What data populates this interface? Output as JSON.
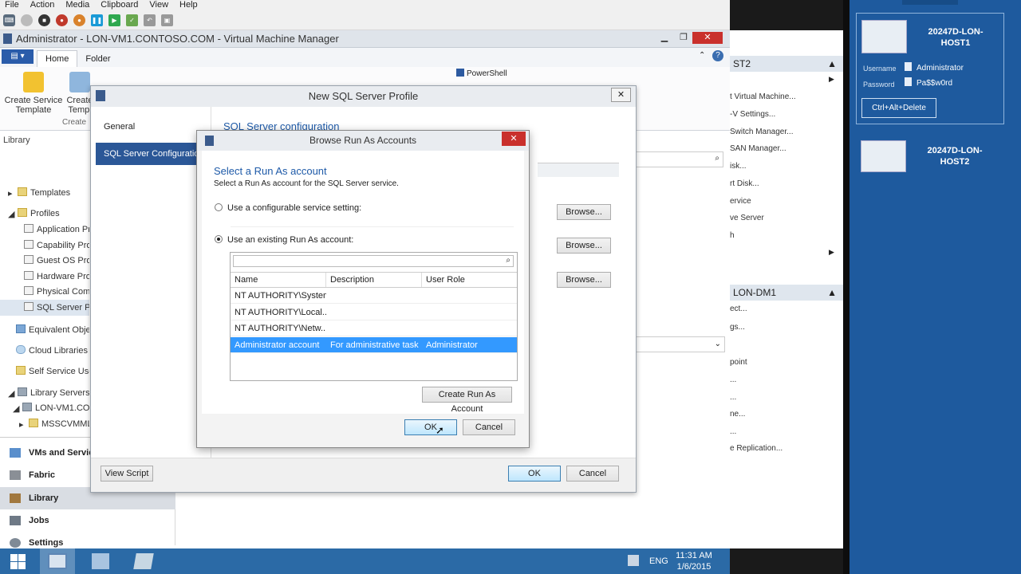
{
  "host_menu": [
    "File",
    "Action",
    "Media",
    "Clipboard",
    "View",
    "Help"
  ],
  "window": {
    "title": "Administrator - LON-VM1.CONTOSO.COM - Virtual Machine Manager",
    "tabs": [
      "Home",
      "Folder"
    ],
    "ribbon": {
      "create_service_template": "Create Service Template",
      "create_template": "Create Templ",
      "group_label": "Create",
      "powershell": "PowerShell"
    }
  },
  "nav": {
    "section": "Library",
    "items": [
      "Templates",
      "Profiles",
      "Application Pr",
      "Capability Prof",
      "Guest OS Profi",
      "Hardware Profi",
      "Physical Comp",
      "SQL Server Pro",
      "Equivalent Obje",
      "Cloud Libraries",
      "Self Service Use",
      "Library Servers",
      "LON-VM1.CON",
      "MSSCVMML"
    ],
    "workspaces": [
      "VMs and Servic",
      "Fabric",
      "Library",
      "Jobs",
      "Settings"
    ]
  },
  "actions": {
    "group1_header": "ST2",
    "group1": [
      "t Virtual Machine...",
      "-V Settings...",
      "Switch Manager...",
      "SAN Manager...",
      "isk...",
      "rt Disk...",
      "ervice",
      "ve Server",
      "h"
    ],
    "group2_header": "LON-DM1",
    "group2": [
      "ect...",
      "gs...",
      "point",
      "...",
      "...",
      "ne...",
      "...",
      "e Replication..."
    ]
  },
  "profile_dialog": {
    "title": "New SQL Server Profile",
    "nav": [
      "General",
      "SQL Server Configuration"
    ],
    "heading": "SQL Server configuration",
    "browse_label": "Browse...",
    "view_script": "View Script",
    "ok": "OK",
    "cancel": "Cancel"
  },
  "browse_dialog": {
    "title": "Browse Run As Accounts",
    "heading": "Select a Run As account",
    "subheading": "Select a Run As account for the SQL Server service.",
    "option1": "Use a configurable service setting:",
    "option2": "Use an existing Run As account:",
    "option_selected": "option2",
    "columns": [
      "Name",
      "Description",
      "User Role"
    ],
    "rows": [
      {
        "name": "NT AUTHORITY\\System",
        "description": "",
        "role": ""
      },
      {
        "name": "NT AUTHORITY\\Local...",
        "description": "",
        "role": ""
      },
      {
        "name": "NT AUTHORITY\\Netw...",
        "description": "",
        "role": ""
      },
      {
        "name": "Administrator account",
        "description": "For administrative task",
        "role": "Administrator"
      }
    ],
    "selected_row": 3,
    "create_button": "Create Run As Account",
    "ok": "OK",
    "cancel": "Cancel"
  },
  "taskbar": {
    "language": "ENG",
    "time": "11:31 AM",
    "date": "1/6/2015"
  },
  "remote": {
    "vm1": {
      "name": "20247D-LON-HOST1",
      "username_label": "Username",
      "username": "Administrator",
      "password_label": "Password",
      "password": "Pa$$w0rd",
      "cad_button": "Ctrl+Alt+Delete"
    },
    "vm2": {
      "name": "20247D-LON-HOST2"
    }
  },
  "colors": {
    "accent": "#3399ff",
    "taskbar": "#2b6aa6",
    "remote_panel": "#1e5a9e"
  }
}
